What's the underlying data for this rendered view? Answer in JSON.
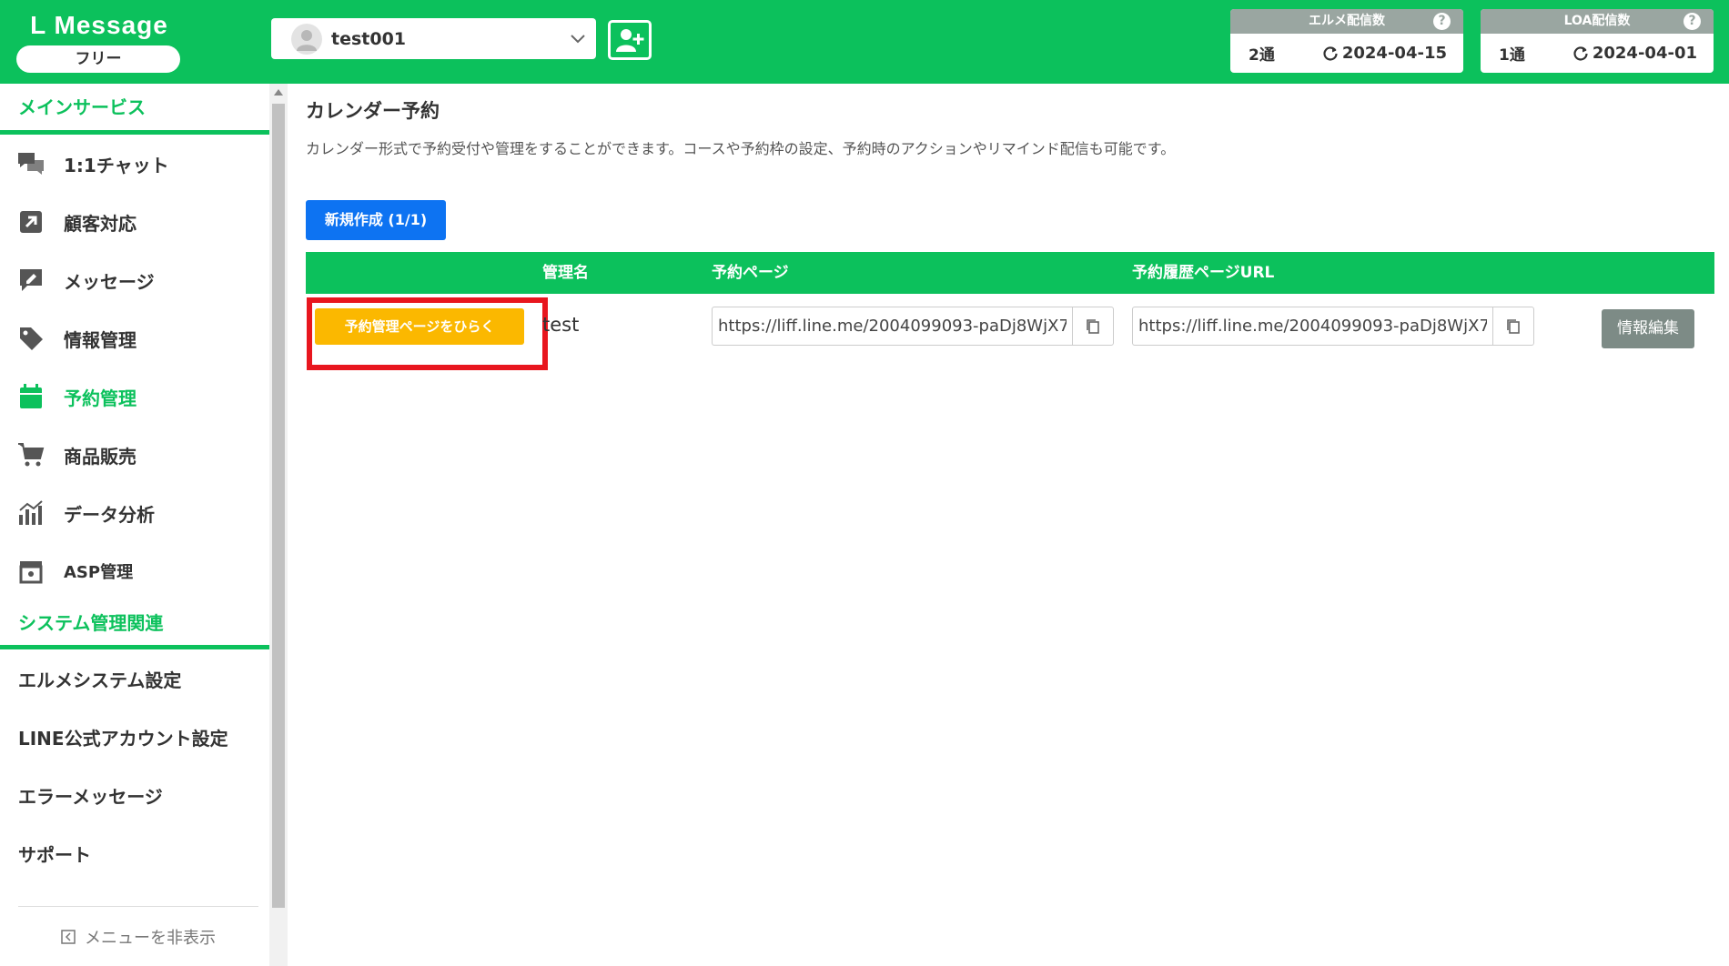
{
  "header": {
    "brand": "L Message",
    "plan": "フリー",
    "account": {
      "name": "test001"
    },
    "stats": [
      {
        "title": "エルメ配信数",
        "count": "2通",
        "date": "2024-04-15"
      },
      {
        "title": "LOA配信数",
        "count": "1通",
        "date": "2024-04-01"
      }
    ],
    "help_glyph": "?"
  },
  "sidebar": {
    "main_title": "メインサービス",
    "items": [
      {
        "label": "1:1チャット",
        "icon": "chat-icon"
      },
      {
        "label": "顧客対応",
        "icon": "arrow-up-right-icon"
      },
      {
        "label": "メッセージ",
        "icon": "message-edit-icon"
      },
      {
        "label": "情報管理",
        "icon": "tag-icon"
      },
      {
        "label": "予約管理",
        "icon": "calendar-icon",
        "active": true
      },
      {
        "label": "商品販売",
        "icon": "cart-icon"
      },
      {
        "label": "データ分析",
        "icon": "chart-icon"
      },
      {
        "label": "ASP管理",
        "icon": "asp-box-icon"
      }
    ],
    "system_title": "システム管理関連",
    "system_items": [
      {
        "label": "エルメシステム設定"
      },
      {
        "label": "LINE公式アカウント設定"
      },
      {
        "label": "エラーメッセージ"
      },
      {
        "label": "サポート"
      }
    ],
    "hide_menu": "メニューを非表示"
  },
  "main": {
    "title": "カレンダー予約",
    "description": "カレンダー形式で予約受付や管理をすることができます。コースや予約枠の設定、予約時のアクションやリマインド配信も可能です。",
    "create_button": "新規作成 (1/1)",
    "table": {
      "headers": {
        "name": "管理名",
        "page": "予約ページ",
        "history": "予約履歴ページURL"
      },
      "rows": [
        {
          "open_button": "予約管理ページをひらく",
          "name": "test",
          "page_url": "https://liff.line.me/2004099093-paDj8WjX7",
          "history_url": "https://liff.line.me/2004099093-paDj8WjX7",
          "edit_button": "情報編集"
        }
      ]
    }
  },
  "colors": {
    "brand_green": "#0cc15c",
    "primary_blue": "#0d73f2",
    "warning_yellow": "#fbb800",
    "highlight_red": "#e8161e",
    "muted_gray": "#7d8b86"
  }
}
